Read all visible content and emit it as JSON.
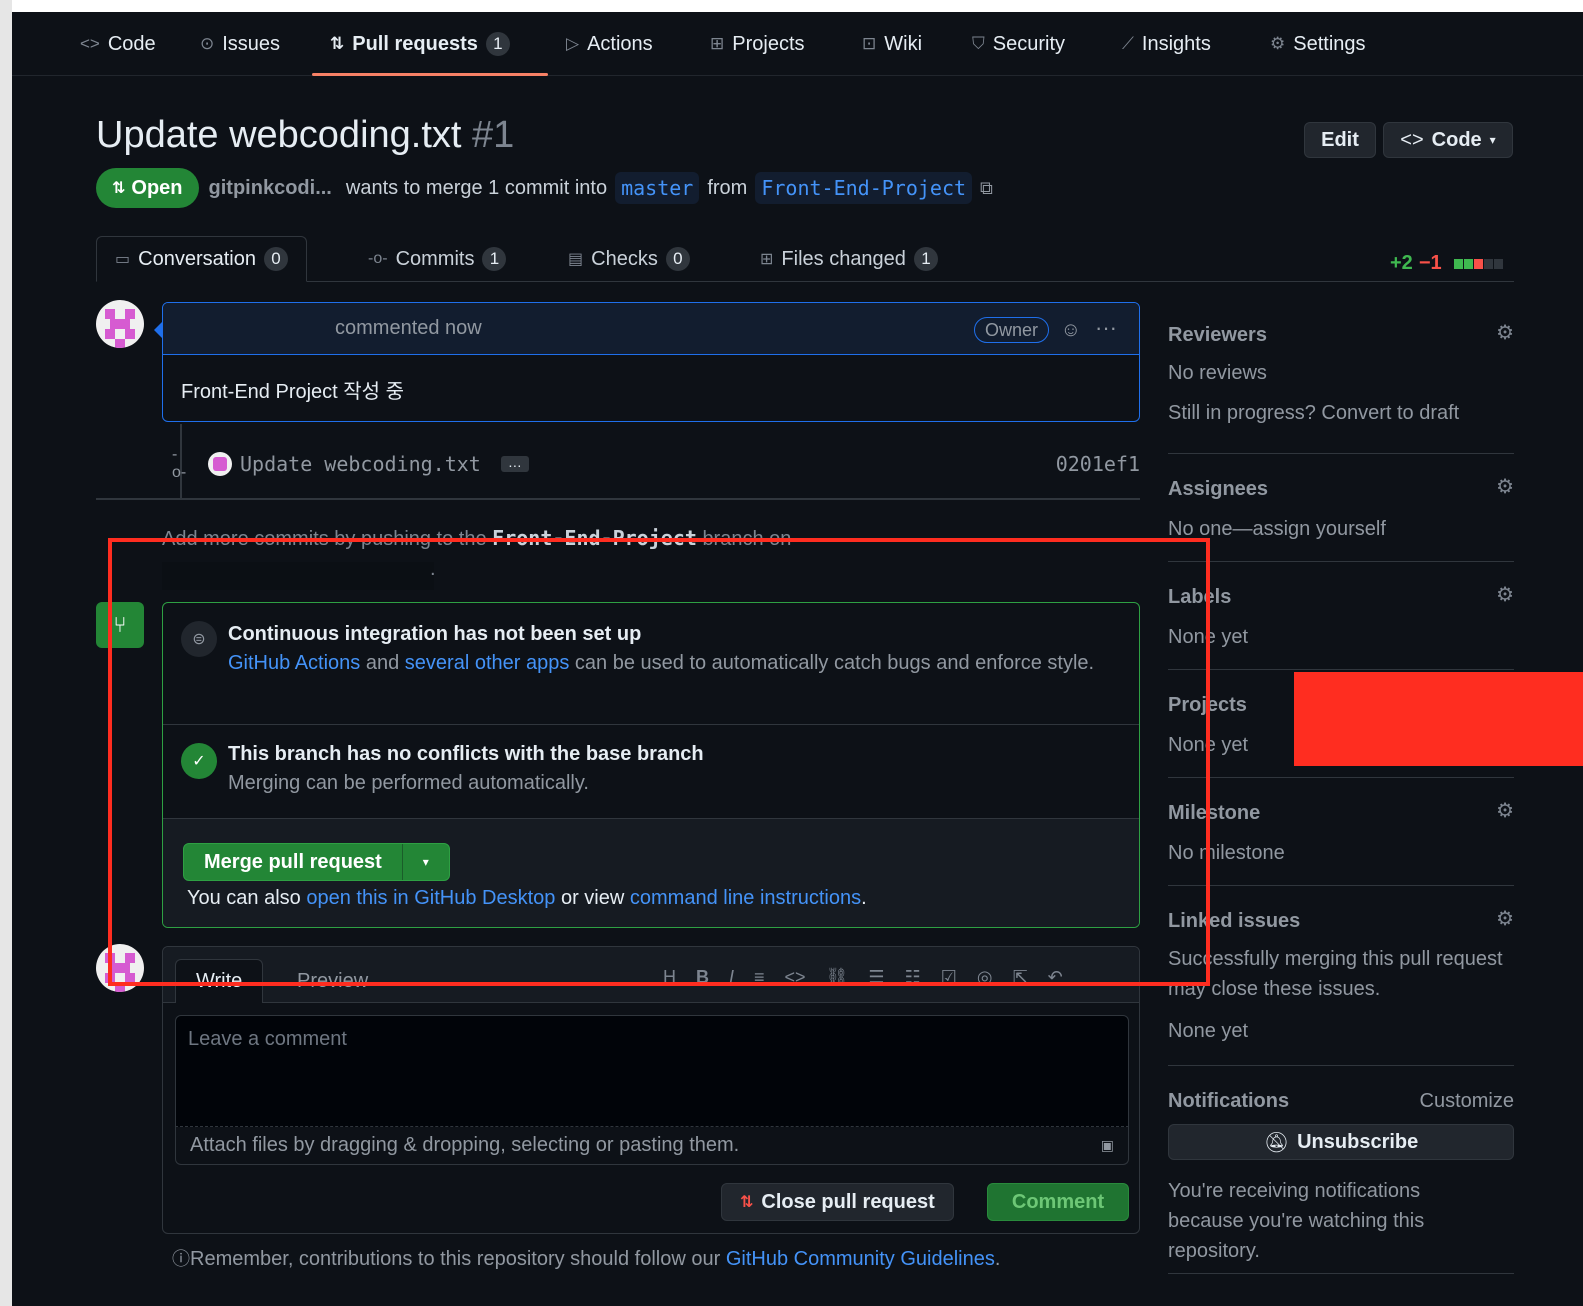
{
  "repo_nav": [
    {
      "label": "Code",
      "icon": "code-icon"
    },
    {
      "label": "Issues",
      "icon": "issue-icon"
    },
    {
      "label": "Pull requests",
      "icon": "pull-request-icon",
      "count": "1",
      "active": true
    },
    {
      "label": "Actions",
      "icon": "play-icon"
    },
    {
      "label": "Projects",
      "icon": "table-icon"
    },
    {
      "label": "Wiki",
      "icon": "book-icon"
    },
    {
      "label": "Security",
      "icon": "shield-icon"
    },
    {
      "label": "Insights",
      "icon": "graph-icon"
    },
    {
      "label": "Settings",
      "icon": "gear-icon"
    }
  ],
  "pr": {
    "title": "Update webcoding.txt",
    "number": "#1",
    "edit_label": "Edit",
    "code_label": "Code",
    "state": "Open",
    "author": "gitpinkcodi...",
    "merge_text": "wants to merge 1 commit into",
    "base_branch": "master",
    "from_text": "from",
    "head_branch": "Front-End-Project"
  },
  "tabs": [
    {
      "label": "Conversation",
      "count": "0"
    },
    {
      "label": "Commits",
      "count": "1"
    },
    {
      "label": "Checks",
      "count": "0"
    },
    {
      "label": "Files changed",
      "count": "1"
    }
  ],
  "diffstat": {
    "additions": "+2",
    "deletions": "−1"
  },
  "comment": {
    "time": "commented now",
    "role": "Owner",
    "body": "Front-End Project 작성 중"
  },
  "commit": {
    "message": "Update webcoding.txt",
    "ellipsis": "…",
    "sha": "0201ef1"
  },
  "hint": {
    "before": "Add more commits by pushing to the",
    "branch": "Front-End-Project",
    "after": "branch on",
    "end": "."
  },
  "merge_box": {
    "ci_title": "Continuous integration has not been set up",
    "ci_link1": "GitHub Actions",
    "ci_and": "and",
    "ci_link2": "several other apps",
    "ci_rest": "can be used to automatically catch bugs and enforce style.",
    "conflict_title": "This branch has no conflicts with the base branch",
    "conflict_text": "Merging can be performed automatically.",
    "merge_button": "Merge pull request",
    "also_prefix": "You can also",
    "also_link1": "open this in GitHub Desktop",
    "also_mid": "or view",
    "also_link2": "command line instructions",
    "also_end": "."
  },
  "editor": {
    "write_tab": "Write",
    "preview_tab": "Preview",
    "placeholder": "Leave a comment",
    "attach_text": "Attach files by dragging & dropping, selecting or pasting them.",
    "close_button": "Close pull request",
    "comment_button": "Comment"
  },
  "remember": {
    "text": "Remember, contributions to this repository should follow our",
    "link": "GitHub Community Guidelines",
    "end": "."
  },
  "sidebar": {
    "reviewers": {
      "title": "Reviewers",
      "line1": "No reviews",
      "line2": "Still in progress? Convert to draft"
    },
    "assignees": {
      "title": "Assignees",
      "text": "No one—assign yourself"
    },
    "labels": {
      "title": "Labels",
      "text": "None yet"
    },
    "projects": {
      "title": "Projects",
      "text": "None yet"
    },
    "milestone": {
      "title": "Milestone",
      "text": "No milestone"
    },
    "linked": {
      "title": "Linked issues",
      "text": "Successfully merging this pull request may close these issues.",
      "none": "None yet"
    },
    "notifications": {
      "title": "Notifications",
      "customize": "Customize",
      "unsubscribe": "Unsubscribe",
      "text": "You're receiving notifications because you're watching this repository."
    }
  },
  "colors": {
    "accent": "#f78166",
    "green": "#238636",
    "blue": "#4493f8",
    "annotation": "#ff2d20"
  }
}
